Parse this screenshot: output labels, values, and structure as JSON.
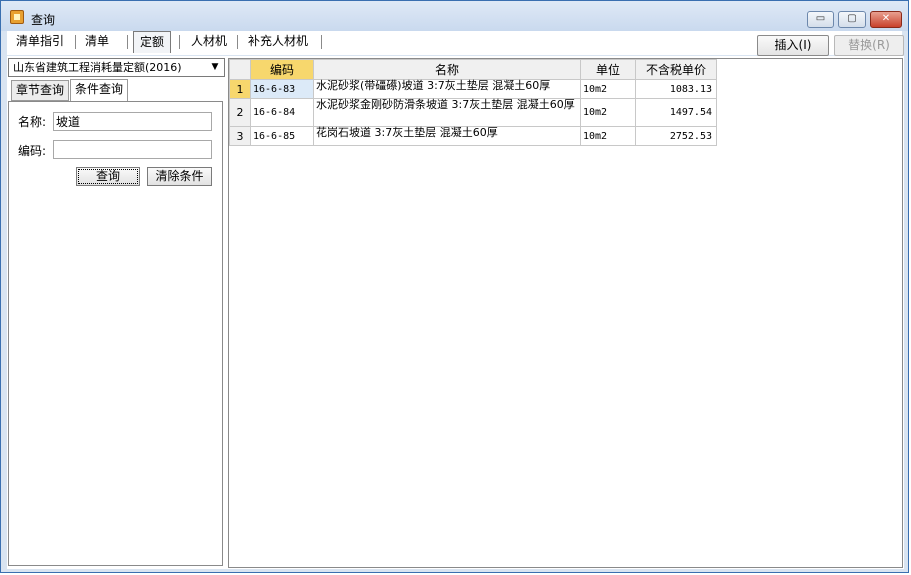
{
  "window": {
    "title": "查询",
    "min_symbol": "▭",
    "max_symbol": "▢",
    "close_symbol": "✕"
  },
  "tabs": [
    {
      "label": "清单指引"
    },
    {
      "label": "清单"
    },
    {
      "label": "定额"
    },
    {
      "label": "人材机"
    },
    {
      "label": "补充人材机"
    }
  ],
  "actions": {
    "insert_label": "插入(I)",
    "replace_label": "替换(R)"
  },
  "left": {
    "library": "山东省建筑工程消耗量定额(2016)",
    "dropdown_arrow": "▼",
    "subtabs": [
      {
        "label": "章节查询"
      },
      {
        "label": "条件查询"
      }
    ],
    "name_label": "名称:",
    "name_value": "坡道",
    "code_label": "编码:",
    "code_value": "",
    "search_label": "查询",
    "clear_label": "清除条件"
  },
  "grid": {
    "headers": {
      "code": "编码",
      "name": "名称",
      "unit": "单位",
      "price": "不含税单价"
    },
    "rows": [
      {
        "num": "1",
        "code": "16-6-83",
        "name": "水泥砂浆(带礓礤)坡道 3:7灰土垫层 混凝土60厚",
        "unit": "10m2",
        "price": "1083.13"
      },
      {
        "num": "2",
        "code": "16-6-84",
        "name": "水泥砂浆金刚砂防滑条坡道 3:7灰土垫层 混凝土60厚",
        "unit": "10m2",
        "price": "1497.54"
      },
      {
        "num": "3",
        "code": "16-6-85",
        "name": "花岗石坡道 3:7灰土垫层 混凝土60厚",
        "unit": "10m2",
        "price": "2752.53"
      }
    ]
  },
  "colors": {
    "header_selected": "#f7d76d",
    "close_button": "#c9412b",
    "window_border": "#3a6fb0"
  }
}
